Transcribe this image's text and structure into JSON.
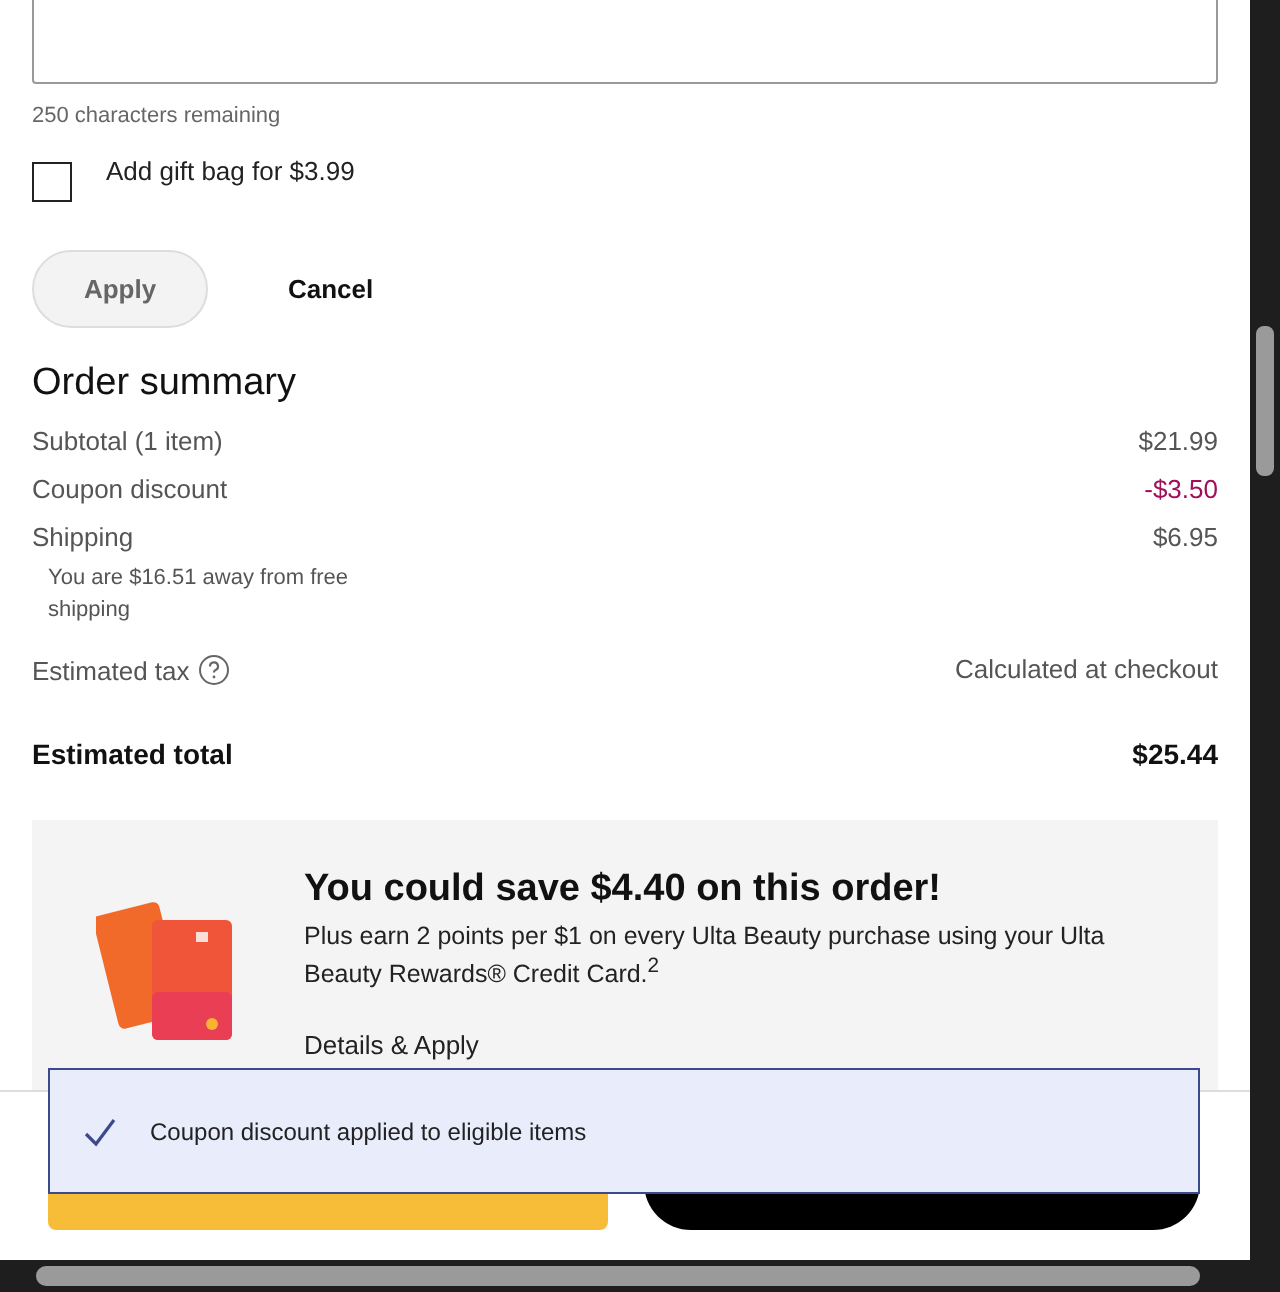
{
  "note_field": {
    "counter": "250 characters remaining"
  },
  "gift_bag": {
    "label": "Add gift bag for $3.99",
    "checked": false
  },
  "actions": {
    "apply": "Apply",
    "cancel": "Cancel"
  },
  "order_summary": {
    "title": "Order summary",
    "rows": [
      {
        "kind": "plain",
        "label": "Subtotal (1 item)",
        "value": "$21.99"
      },
      {
        "kind": "discount",
        "label": "Coupon discount",
        "value": "-$3.50"
      },
      {
        "kind": "plain",
        "label": "Shipping",
        "value": "$6.95",
        "note": "You are $16.51 away from free shipping"
      },
      {
        "kind": "info",
        "label": "Estimated tax",
        "value": "Calculated at checkout"
      }
    ],
    "total": {
      "label": "Estimated total",
      "value": "$25.44"
    }
  },
  "promo": {
    "title": "You could save $4.40 on this order!",
    "text": "Plus earn 2 points per $1 on every Ulta Beauty purchase using your Ulta Beauty Rewards® Credit Card.$^{2}$",
    "link": "Details & Apply"
  },
  "toast": {
    "message": "Coupon discount applied to eligible items"
  }
}
